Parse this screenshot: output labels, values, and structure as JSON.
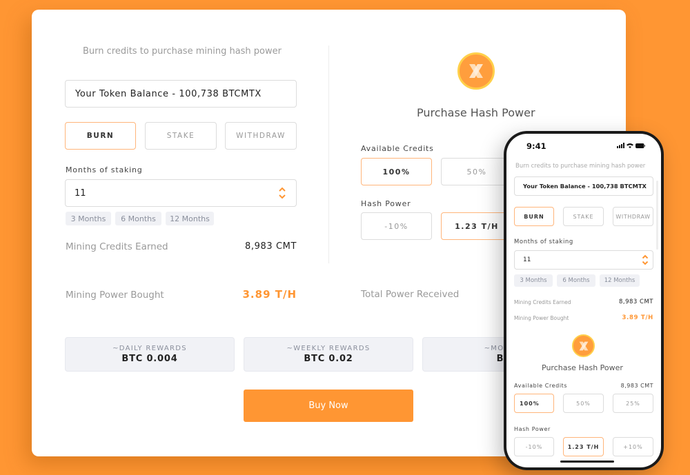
{
  "desktop": {
    "subtitle": "Burn credits to purchase mining hash power",
    "token_balance": "Your Token Balance - 100,738 BTCMTX",
    "tabs": [
      {
        "label": "BURN",
        "active": true
      },
      {
        "label": "STAKE",
        "active": false
      },
      {
        "label": "WITHDRAW",
        "active": false
      }
    ],
    "months_label": "Months of staking",
    "months_value": "11",
    "month_chips": [
      "3 Months",
      "6 Months",
      "12 Months"
    ],
    "credits_earned_label": "Mining Credits Earned",
    "credits_earned_value": "8,983 CMT",
    "power_bought_label": "Mining Power Bought",
    "power_bought_value": "3.89 T/H",
    "purchase_title": "Purchase Hash Power",
    "available_credits_label": "Available Credits",
    "credit_options": [
      {
        "label": "100%",
        "active": true
      },
      {
        "label": "50%",
        "active": false
      }
    ],
    "hash_power_label": "Hash Power",
    "hash_options": [
      {
        "label": "-10%",
        "active": false
      },
      {
        "label": "1.23 T/H",
        "active": true
      }
    ],
    "total_power_label": "Total Power Received",
    "rewards": [
      {
        "label": "~DAILY REWARDS",
        "value": "BTC 0.004"
      },
      {
        "label": "~WEEKLY REWARDS",
        "value": "BTC 0.02"
      },
      {
        "label": "~MONTHLY",
        "value": "BTC"
      }
    ],
    "buy_label": "Buy Now"
  },
  "phone": {
    "time": "9:41",
    "subtitle": "Burn credits to purchase mining hash power",
    "token_balance": "Your Token Balance - 100,738 BTCMTX",
    "tabs": [
      {
        "label": "BURN",
        "active": true
      },
      {
        "label": "STAKE",
        "active": false
      },
      {
        "label": "WITHDRAW",
        "active": false
      }
    ],
    "months_label": "Months of staking",
    "months_value": "11",
    "month_chips": [
      "3 Months",
      "6 Months",
      "12 Months"
    ],
    "credits_earned_label": "Mining Credits Earned",
    "credits_earned_value": "8,983 CMT",
    "power_bought_label": "Mining Power Bought",
    "power_bought_value": "3.89 T/H",
    "purchase_title": "Purchase Hash Power",
    "available_credits_label": "Available Credits",
    "available_credits_value": "8,983 CMT",
    "credit_options": [
      {
        "label": "100%",
        "active": true
      },
      {
        "label": "50%",
        "active": false
      },
      {
        "label": "25%",
        "active": false
      }
    ],
    "hash_power_label": "Hash Power",
    "hash_options": [
      {
        "label": "-10%",
        "active": false
      },
      {
        "label": "1.23 T/H",
        "active": true
      },
      {
        "label": "+10%",
        "active": false
      }
    ]
  },
  "colors": {
    "accent": "#FF9633",
    "active_border": "#FFB57A",
    "chip_bg": "#F0F1F5",
    "coin_ring": "#FFD04A"
  }
}
